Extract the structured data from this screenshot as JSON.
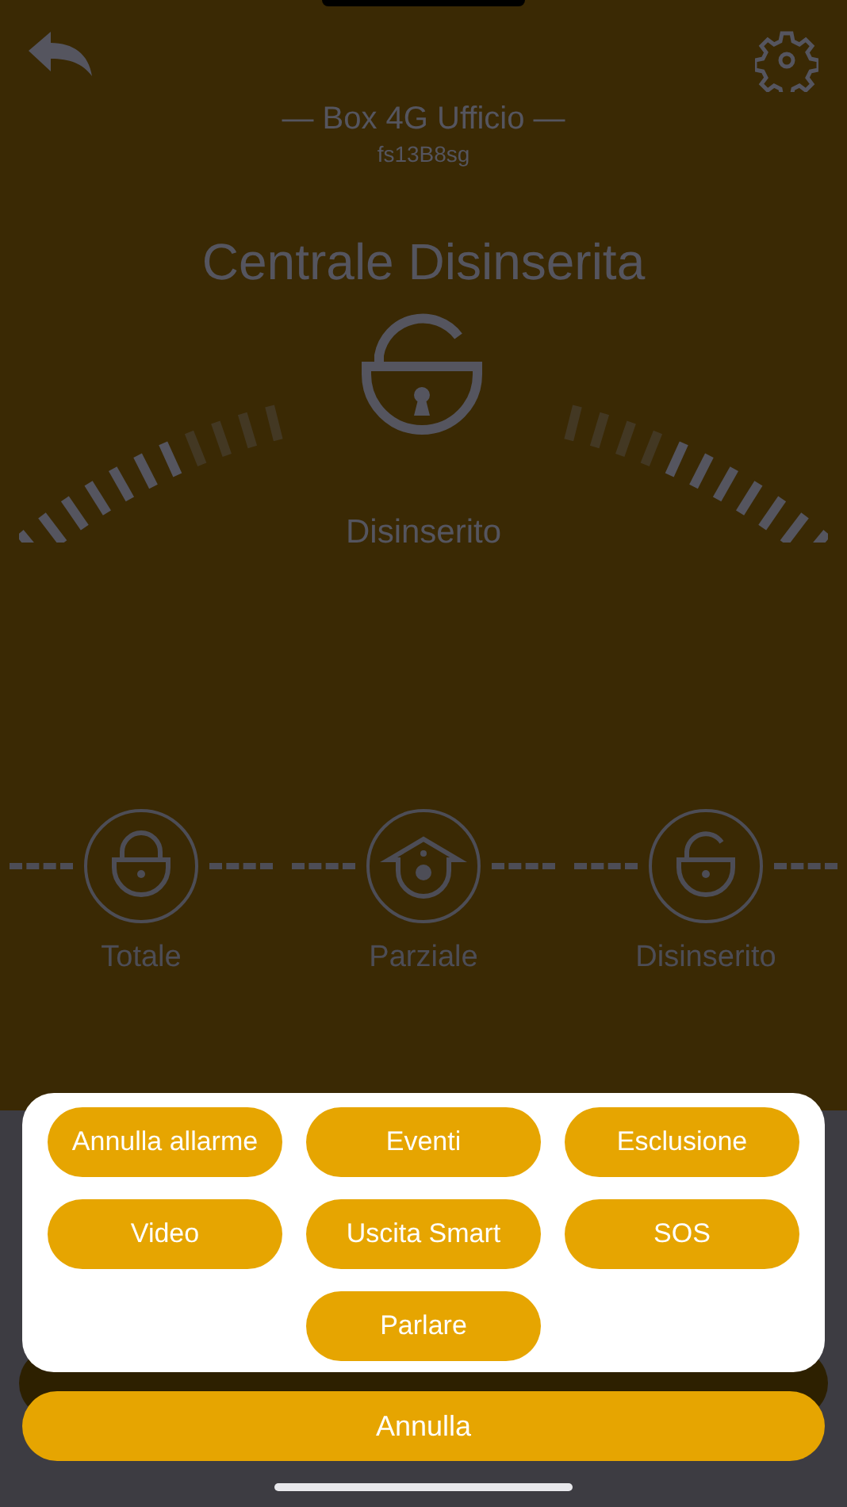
{
  "header": {
    "title": "— Box 4G Ufficio —",
    "subtitle": "fs13B8sg"
  },
  "status": {
    "title": "Centrale Disinserita",
    "label": "Disinserito"
  },
  "modes": [
    {
      "kind": "total",
      "label": "Totale"
    },
    {
      "kind": "partial",
      "label": "Parziale"
    },
    {
      "kind": "off",
      "label": "Disinserito"
    }
  ],
  "actions": [
    "Annulla allarme",
    "Eventi",
    "Esclusione",
    "Video",
    "Uscita Smart",
    "SOS",
    "Parlare"
  ],
  "cancel": "Annulla"
}
